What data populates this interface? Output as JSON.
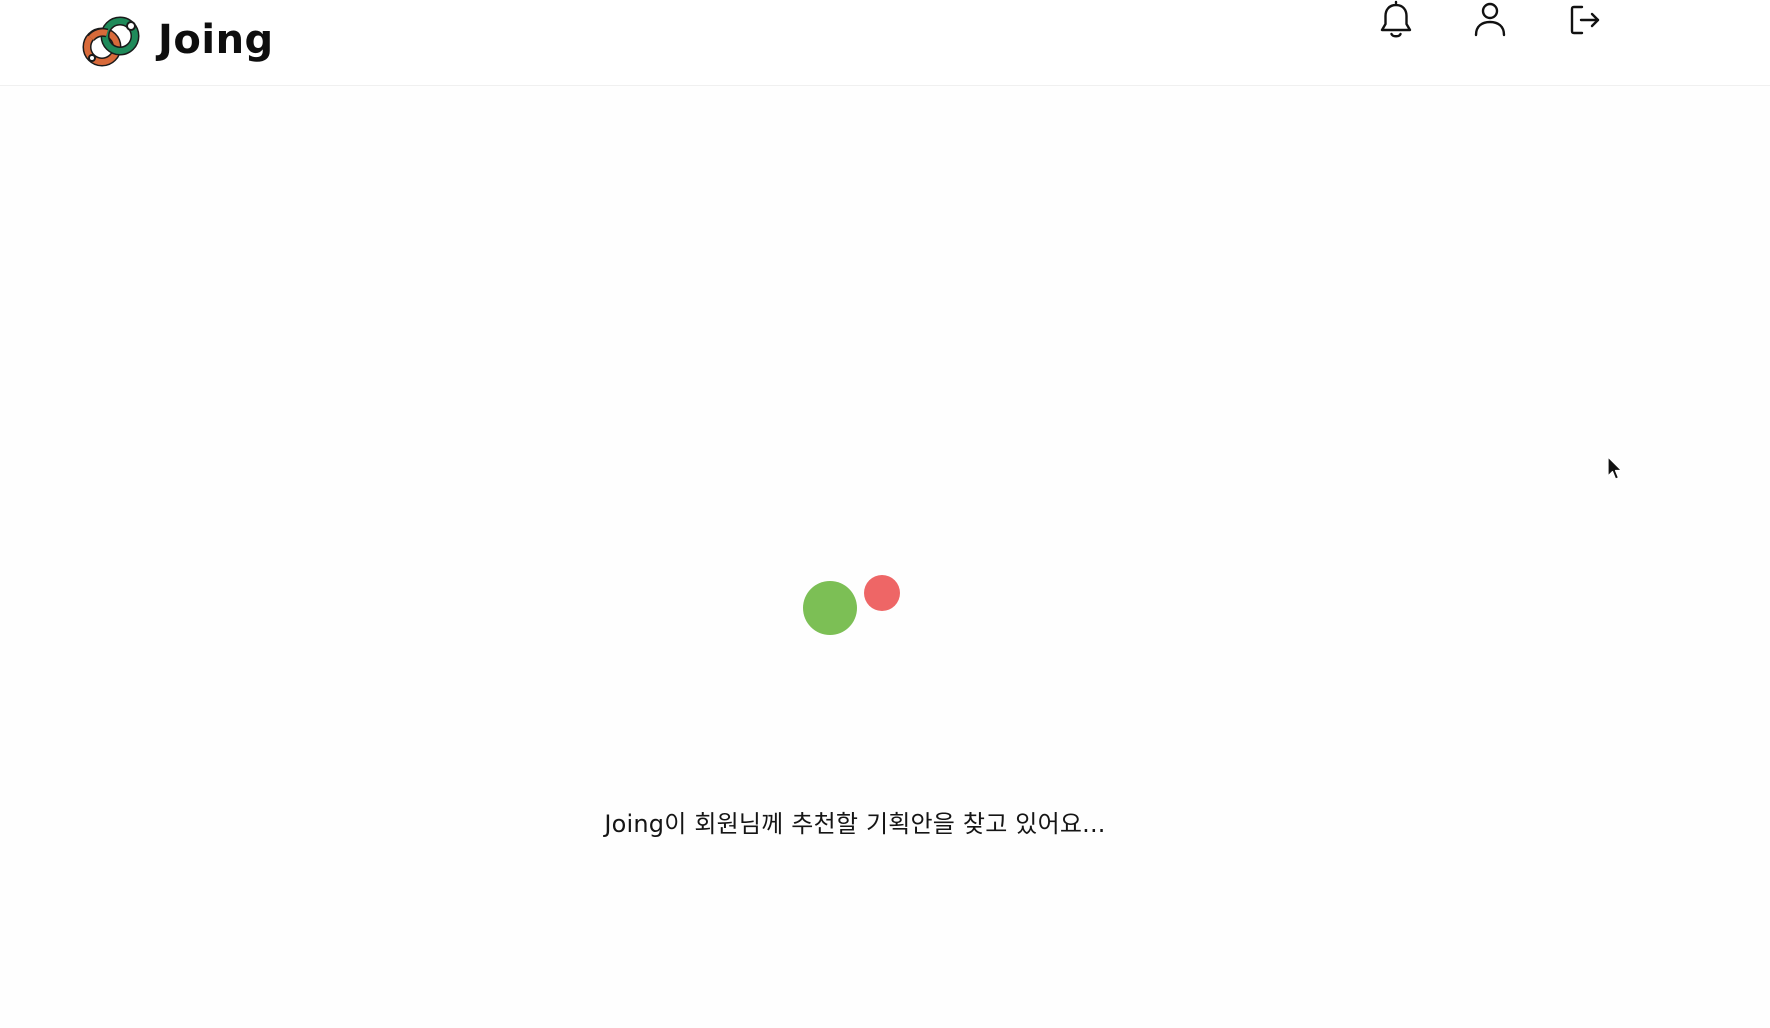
{
  "header": {
    "brand_name": "Joing",
    "logo_colors": {
      "green": "#1f8a5a",
      "orange": "#d86a3a",
      "outline": "#1a1a1a"
    },
    "icons": {
      "notifications": "bell-icon",
      "profile": "user-icon",
      "logout": "logout-icon"
    }
  },
  "main": {
    "loader": {
      "dot_colors": [
        "#7cbf55",
        "#ee6666"
      ]
    },
    "loading_message": "Joing이 회원님께 추천할 기획안을 찾고 있어요..."
  }
}
